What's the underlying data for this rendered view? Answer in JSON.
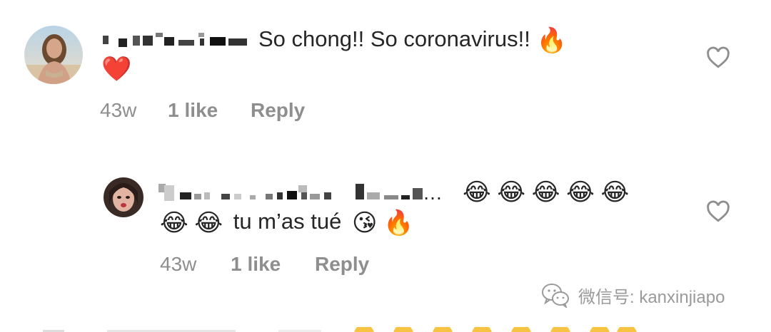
{
  "comments": [
    {
      "username": "▖▗▖▗▖▘▖▗▖▘▖",
      "text": "So chong!! So coronavirus!!",
      "emojis_after_text": [
        "🔥"
      ],
      "emojis_line2": [
        "❤️"
      ],
      "time": "43w",
      "likes": "1 like",
      "reply": "Reply"
    },
    {
      "username": "▖▗▖ ▖▗▖ ▗▘▖▗ ▗▖▗▖",
      "username_suffix": "…",
      "emojis_after_username": [
        "😂",
        "😂",
        "😂",
        "😂",
        "😂"
      ],
      "emojis_line2_before": [
        "😂",
        "😂"
      ],
      "text": "tu m’as tué",
      "emojis_after_text": [
        "😘",
        "🔥"
      ],
      "time": "43w",
      "likes": "1 like",
      "reply": "Reply"
    }
  ],
  "watermark": {
    "text": "微信号: kanxinjiapo"
  },
  "icons": {
    "like": "heart-outline-icon",
    "wechat": "wechat-logo-icon"
  },
  "colors": {
    "text": "#262626",
    "meta": "#8e8e8e",
    "heart_emoji": "#e0183a",
    "fire": "#f5641e"
  }
}
